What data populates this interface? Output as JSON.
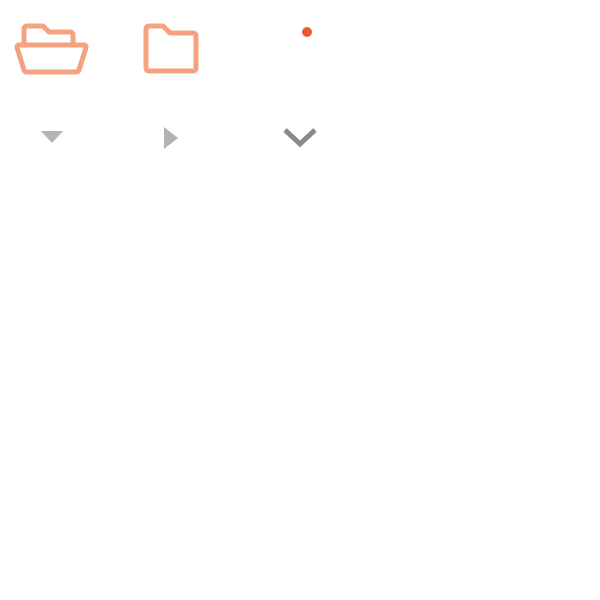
{
  "icons": {
    "folder_open": {
      "name": "folder-open-icon",
      "color": "#f4a27f"
    },
    "folder_closed": {
      "name": "folder-icon",
      "color": "#f4a27f"
    },
    "notification_dot": {
      "name": "notification-dot",
      "color": "#e85d2c"
    },
    "caret_down": {
      "name": "caret-down-icon",
      "color": "#b3b3b3"
    },
    "caret_right": {
      "name": "caret-right-icon",
      "color": "#b3b3b3"
    },
    "chevron_down": {
      "name": "chevron-down-icon",
      "color": "#8a8a8a"
    }
  }
}
